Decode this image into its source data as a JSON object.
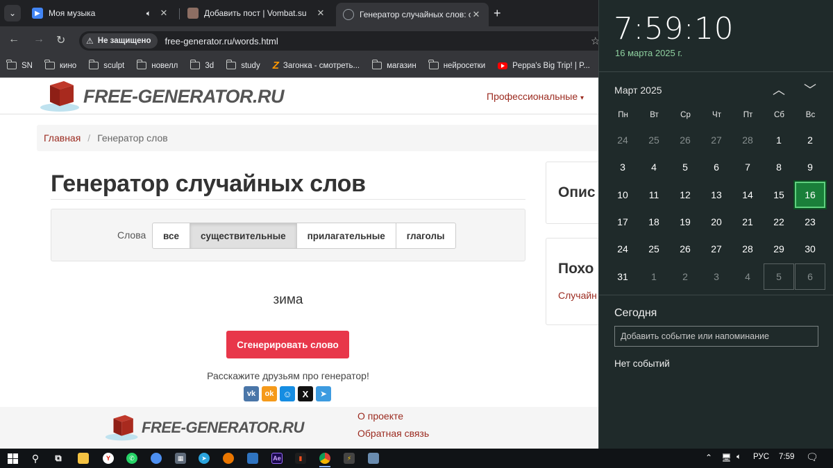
{
  "browser": {
    "tabs": [
      {
        "title": "Моя музыка",
        "favicon": "play-icon",
        "accent": "#4285f4",
        "has_sound": true
      },
      {
        "title": "Добавить пост | Vombat.su",
        "favicon": "wombat-icon",
        "accent": "#8d6e63"
      },
      {
        "title": "Генератор случайных слов: су",
        "favicon": "globe-icon",
        "accent": "#9aa0a6",
        "active": true
      }
    ],
    "address": {
      "security_label": "Не защищено",
      "url": "free-generator.ru/words.html"
    },
    "bookmarks": [
      "SN",
      "кино",
      "sculpt",
      "новелл",
      "3d",
      "study",
      "Загонка - смотреть...",
      "магазин",
      "нейросетки",
      "Peppa's Big Trip! | P..."
    ]
  },
  "site": {
    "logo_text": "FREE-GENERATOR.RU",
    "nav_professional": "Профессиональные",
    "breadcrumb": {
      "home": "Главная",
      "separator": "/",
      "current": "Генератор слов"
    },
    "title": "Генератор случайных слов",
    "filter": {
      "label": "Слова",
      "options": [
        "все",
        "существительные",
        "прилагательные",
        "глаголы"
      ],
      "selected": "существительные"
    },
    "generated_word": "зима",
    "generate_button": "Сгенерировать слово",
    "share_text": "Расскажите друзьям про генератор!",
    "social": [
      {
        "name": "vk-icon",
        "glyph": "vk",
        "color": "#4a76a8"
      },
      {
        "name": "odnoklassniki-icon",
        "glyph": "ok",
        "color": "#f59a1b"
      },
      {
        "name": "moimir-icon",
        "glyph": "☺",
        "color": "#168de2"
      },
      {
        "name": "x-icon",
        "glyph": "𝕏",
        "color": "#111111"
      },
      {
        "name": "telegram-icon",
        "glyph": "➤",
        "color": "#3d9be0"
      }
    ],
    "sidebar": {
      "heading1": "Опис",
      "heading2": "Похо",
      "link": "Случайн"
    },
    "footer": {
      "logo_text": "FREE-GENERATOR.RU",
      "link_about": "О проекте",
      "link_feedback": "Обратная связь"
    },
    "accent_color": "#9b2a1f",
    "button_color": "#e8374a"
  },
  "calendar": {
    "time": "7:59:10",
    "date": "16 марта 2025 г.",
    "month": "Март 2025",
    "weekdays": [
      "Пн",
      "Вт",
      "Ср",
      "Чт",
      "Пт",
      "Сб",
      "Вс"
    ],
    "weeks": [
      [
        "24",
        "25",
        "26",
        "27",
        "28",
        "1",
        "2"
      ],
      [
        "3",
        "4",
        "5",
        "6",
        "7",
        "8",
        "9"
      ],
      [
        "10",
        "11",
        "12",
        "13",
        "14",
        "15",
        "16"
      ],
      [
        "17",
        "18",
        "19",
        "20",
        "21",
        "22",
        "23"
      ],
      [
        "24",
        "25",
        "26",
        "27",
        "28",
        "29",
        "30"
      ],
      [
        "31",
        "1",
        "2",
        "3",
        "4",
        "5",
        "6"
      ]
    ],
    "today": "16",
    "today_heading": "Сегодня",
    "event_placeholder": "Добавить событие или напоминание",
    "no_events": "Нет событий"
  },
  "taskbar": {
    "language": "РУС",
    "time": "7:59"
  }
}
